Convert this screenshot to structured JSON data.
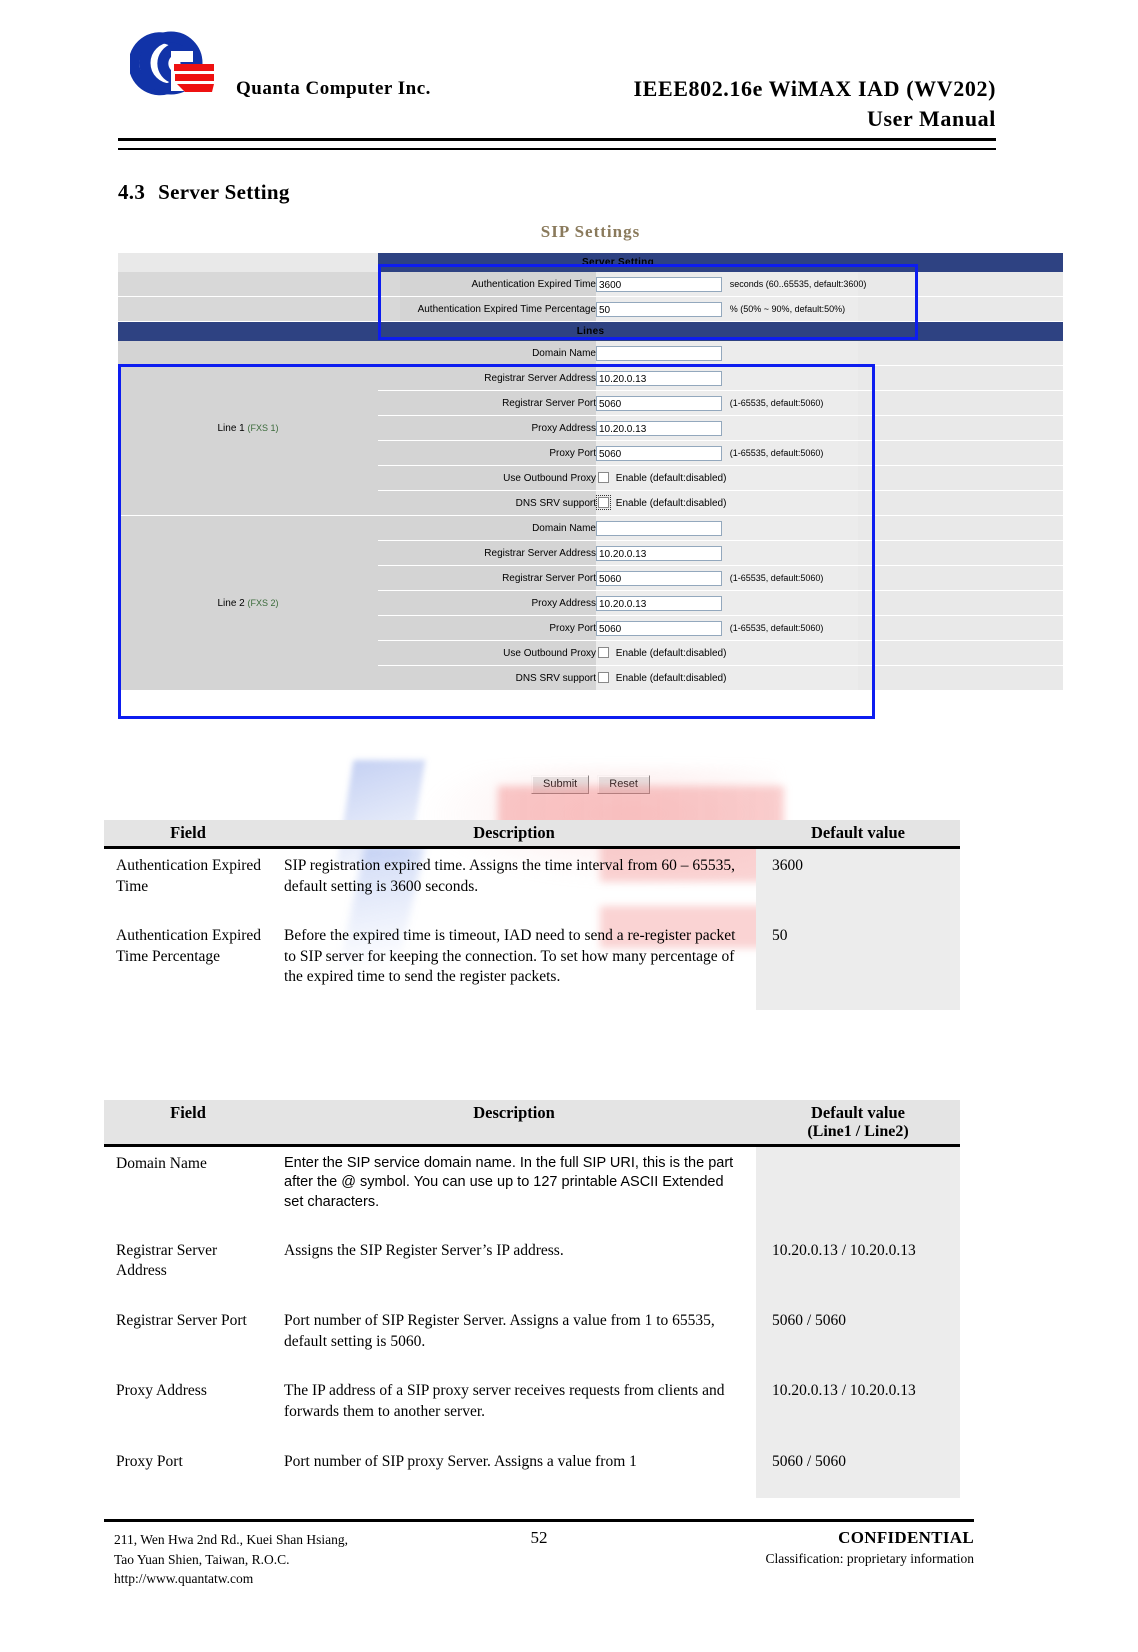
{
  "header": {
    "company": "Quanta  Computer  Inc.",
    "title_line1": "IEEE802.16e  WiMAX  IAD  (WV202)",
    "title_line2": "User  Manual",
    "logo_name": "quanta-logo"
  },
  "section": {
    "number": "4.3",
    "title": "Server Setting"
  },
  "webui": {
    "heading": "SIP Settings",
    "server_setting_bar": "Server Setting",
    "lines_bar": "Lines",
    "server_rows": [
      {
        "label": "Authentication Expired Time",
        "value": "3600",
        "hint": "seconds (60..65535, default:3600)"
      },
      {
        "label": "Authentication Expired Time Percentage",
        "value": "50",
        "hint": "% (50% ~ 90%, default:50%)"
      }
    ],
    "lines": [
      {
        "name": "Line 1",
        "fxs": "(FXS 1)",
        "fields": [
          {
            "label": "Domain Name",
            "value": "",
            "hint": "",
            "type": "text"
          },
          {
            "label": "Registrar Server Address",
            "value": "10.20.0.13",
            "hint": "",
            "type": "text"
          },
          {
            "label": "Registrar Server Port",
            "value": "5060",
            "hint": "(1-65535, default:5060)",
            "type": "text"
          },
          {
            "label": "Proxy Address",
            "value": "10.20.0.13",
            "hint": "",
            "type": "text"
          },
          {
            "label": "Proxy Port",
            "value": "5060",
            "hint": "(1-65535, default:5060)",
            "type": "text"
          },
          {
            "label": "Use Outbound Proxy",
            "value": "",
            "hint": "Enable (default:disabled)",
            "type": "checkbox"
          },
          {
            "label": "DNS SRV support",
            "value": "",
            "hint": "Enable (default:disabled)",
            "type": "checkbox"
          }
        ]
      },
      {
        "name": "Line 2",
        "fxs": "(FXS 2)",
        "fields": [
          {
            "label": "Domain Name",
            "value": "",
            "hint": "",
            "type": "text"
          },
          {
            "label": "Registrar Server Address",
            "value": "10.20.0.13",
            "hint": "",
            "type": "text"
          },
          {
            "label": "Registrar Server Port",
            "value": "5060",
            "hint": "(1-65535, default:5060)",
            "type": "text"
          },
          {
            "label": "Proxy Address",
            "value": "10.20.0.13",
            "hint": "",
            "type": "text"
          },
          {
            "label": "Proxy Port",
            "value": "5060",
            "hint": "(1-65535, default:5060)",
            "type": "text"
          },
          {
            "label": "Use Outbound Proxy",
            "value": "",
            "hint": "Enable (default:disabled)",
            "type": "checkbox"
          },
          {
            "label": "DNS SRV support",
            "value": "",
            "hint": "Enable (default:disabled)",
            "type": "checkbox"
          }
        ]
      }
    ],
    "submit_label": "Submit",
    "reset_label": "Reset",
    "colors": {
      "bar_blue": "#2e4282",
      "annotation_blue": "#0d1df0",
      "label_gray": "#d4d4d4",
      "value_gray": "#ececec",
      "heading_gold": "#8a7a5c"
    }
  },
  "table1": {
    "headers": {
      "field": "Field",
      "description": "Description",
      "default": "Default value"
    },
    "rows": [
      {
        "field": "Authentication Expired Time",
        "description": "SIP registration expired time. Assigns the time interval from 60 – 65535, default setting is 3600 seconds.",
        "default": "3600"
      },
      {
        "field": "Authentication Expired Time Percentage",
        "description": "Before the expired time is timeout, IAD need to send a re-register packet to SIP server for keeping the connection. To set how many percentage of the expired time to send the register packets.",
        "default": "50"
      }
    ]
  },
  "table2": {
    "headers": {
      "field": "Field",
      "description": "Description",
      "default": "Default value",
      "default_sub": "(Line1 / Line2)"
    },
    "rows": [
      {
        "field": "Domain Name",
        "description": "Enter the SIP service domain name. In the full SIP URI, this is the part after the @ symbol. You can use up to 127 printable ASCII Extended set characters.",
        "default": ""
      },
      {
        "field": "Registrar Server Address",
        "description": "Assigns the SIP Register Server’s IP address.",
        "default": "10.20.0.13 / 10.20.0.13"
      },
      {
        "field": "Registrar Server Port",
        "description": "Port number of SIP Register Server. Assigns a value from 1 to 65535, default setting is 5060.",
        "default": "5060 / 5060"
      },
      {
        "field": "Proxy Address",
        "description": "The IP address of a SIP proxy server receives requests from clients and forwards them to another server.",
        "default": "10.20.0.13 / 10.20.0.13"
      },
      {
        "field": "Proxy Port",
        "description": "Port number of SIP proxy Server. Assigns a value from 1",
        "default": "5060 / 5060"
      }
    ]
  },
  "footer": {
    "address_line1": "211, Wen Hwa 2nd Rd., Kuei Shan Hsiang,",
    "address_line2": "Tao Yuan Shien, Taiwan, R.O.C.",
    "website": "http://www.quantatw.com",
    "page_number": "52",
    "confidential": "CONFIDENTIAL",
    "classification": "Classification: proprietary information"
  }
}
